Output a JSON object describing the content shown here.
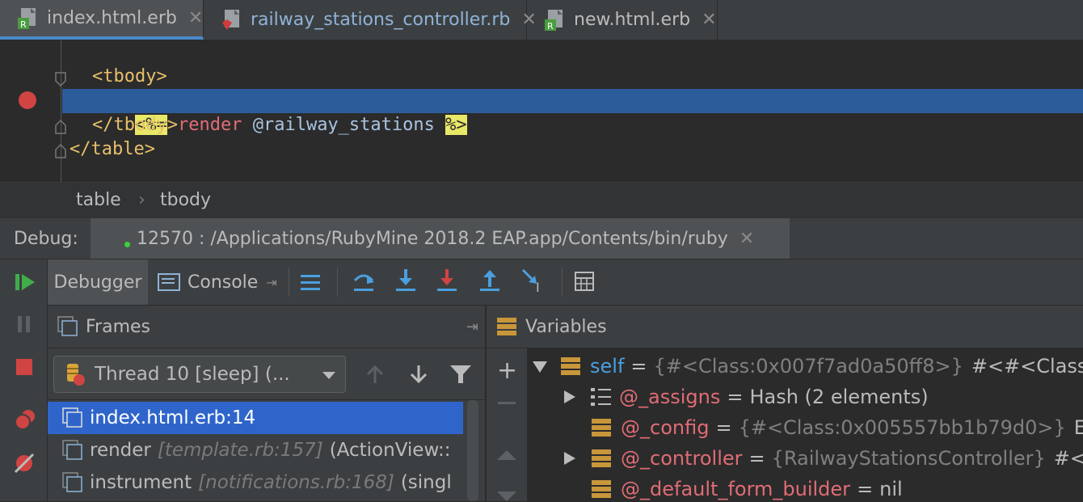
{
  "tabs": [
    {
      "label": "index.html.erb",
      "icon": "erb-file-icon",
      "active": true
    },
    {
      "label": "railway_stations_controller.rb",
      "icon": "ruby-file-icon",
      "active": false
    },
    {
      "label": "new.html.erb",
      "icon": "erb-file-icon",
      "active": false
    }
  ],
  "editor": {
    "line1": "<tbody>",
    "line2_open": "<%=",
    "line2_kw": "render",
    "line2_var": "@railway_stations",
    "line2_close": "%>",
    "line3": "</tbody>",
    "line4": "</table>"
  },
  "breadcrumb": [
    "table",
    "tbody"
  ],
  "debug": {
    "label": "Debug:",
    "session": "12570 : /Applications/RubyMine 2018.2 EAP.app/Contents/bin/ruby"
  },
  "debugger_tabs": {
    "debugger": "Debugger",
    "console": "Console"
  },
  "frames": {
    "title": "Frames",
    "thread": "Thread 10 [sleep] (...",
    "rows": [
      {
        "name": "index.html.erb:14",
        "meta": "",
        "ctx": ""
      },
      {
        "name": "render",
        "meta": "[template.rb:157]",
        "ctx": "(ActionView::"
      },
      {
        "name": "instrument",
        "meta": "[notifications.rb:168]",
        "ctx": "(singl"
      }
    ]
  },
  "variables": {
    "title": "Variables",
    "rows": [
      {
        "expand": true,
        "name": "self",
        "eq": "=",
        "type": "{#<Class:0x007f7ad0a50ff8>}",
        "value": "#<#<Class:0x"
      },
      {
        "expand": true,
        "name": "@_assigns",
        "eq": "=",
        "type": "",
        "value": "Hash (2 elements)"
      },
      {
        "expand": false,
        "name": "@_config",
        "eq": "=",
        "type": "{#<Class:0x005557bb1b79d0>}",
        "value": "Em"
      },
      {
        "expand": true,
        "name": "@_controller",
        "eq": "=",
        "type": "{RailwayStationsController}",
        "value": "#<R"
      },
      {
        "expand": false,
        "name": "@_default_form_builder",
        "eq": "=",
        "type": "",
        "value": "nil"
      }
    ]
  },
  "colors": {
    "accent": "#2f65ca",
    "highlight_line": "#2d5c9b",
    "breakpoint": "#d04444",
    "resume": "#3fae4a"
  }
}
